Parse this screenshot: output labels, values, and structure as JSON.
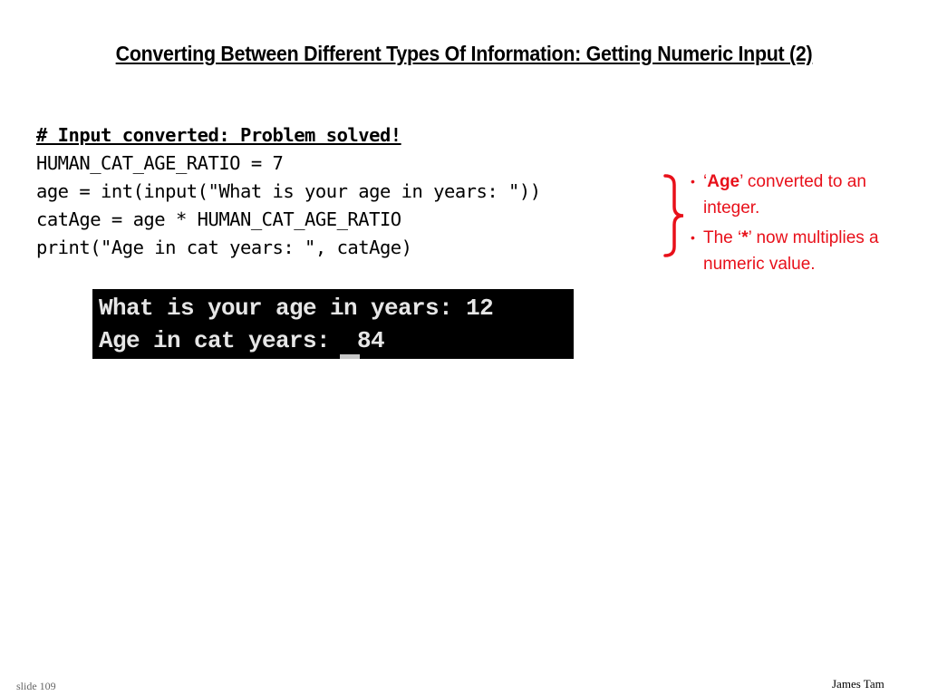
{
  "slide": {
    "title": "Converting Between Different Types Of Information: Getting Numeric Input  (2)",
    "code": {
      "comment": "# Input converted: Problem solved!",
      "lines": [
        "HUMAN_CAT_AGE_RATIO = 7",
        "age = int(input(\"What is your age in years: \"))",
        "catAge = age * HUMAN_CAT_AGE_RATIO",
        "print(\"Age in cat years: \", catAge)"
      ]
    },
    "notes": [
      {
        "bullet": "•",
        "open_quote": "‘",
        "keyword": "Age",
        "close_text": "’ converted to an integer."
      },
      {
        "bullet": "•",
        "pre_text": "The ‘",
        "keyword": "*",
        "close_text": "’ now multiplies a numeric value."
      }
    ],
    "console": {
      "lines": [
        "What is your age in years: 12",
        "Age in cat years:  84"
      ],
      "input_value": "12",
      "output_value": "84"
    },
    "footer": {
      "slide_number": "slide 109",
      "author": "James Tam"
    },
    "colors": {
      "note_text": "#e8101a",
      "console_bg": "#000000",
      "console_text": "#e6e6e6"
    }
  }
}
